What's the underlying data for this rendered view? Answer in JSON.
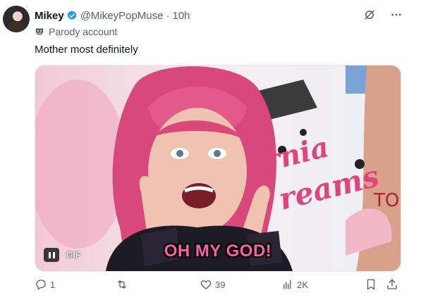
{
  "post": {
    "display_name": "Mikey",
    "handle": "@MikeyPopMuse",
    "separator": "·",
    "time": "10h",
    "label": "Parody account",
    "text": "Mother most definitely"
  },
  "media": {
    "badge": "GIF",
    "caption": "OH MY GOD!",
    "background_text_1": "rnia",
    "background_text_2": "reams",
    "background_text_3": "TO"
  },
  "actions": {
    "replies": "1",
    "reposts": "",
    "likes": "39",
    "views": "2K"
  },
  "colors": {
    "verified": "#1d9bf0",
    "muted": "#536471",
    "caption_fill": "#ff5fa8"
  },
  "icons": {
    "avatar": "avatar",
    "verified": "verified-badge-icon",
    "grok": "grok-icon",
    "more": "more-icon",
    "parody": "mask-icon",
    "reply": "reply-icon",
    "repost": "repost-icon",
    "like": "heart-icon",
    "views": "views-icon",
    "bookmark": "bookmark-icon",
    "share": "share-icon"
  }
}
